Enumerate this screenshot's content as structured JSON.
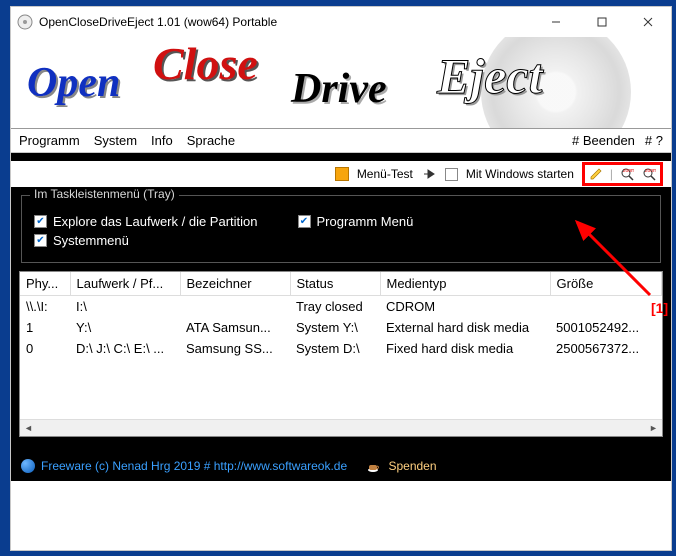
{
  "window": {
    "title": "OpenCloseDriveEject 1.01  (wow64)  Portable"
  },
  "banner": {
    "w1": "Open",
    "w2": "Close",
    "w3": "Drive",
    "w4": "Eject"
  },
  "menu": {
    "items": [
      "Programm",
      "System",
      "Info",
      "Sprache"
    ],
    "right": [
      "# Beenden",
      "# ?"
    ]
  },
  "toolbar": {
    "menu_test": "Menü-Test",
    "autostart": "Mit Windows starten"
  },
  "tray_group": {
    "legend": "Im Taskleistenmenü (Tray)",
    "opt1": "Explore das Laufwerk / die Partition",
    "opt2": "Programm Menü",
    "opt3": "Systemmenü"
  },
  "table": {
    "headers": [
      "Phy...",
      "Laufwerk / Pf...",
      "Bezeichner",
      "Status",
      "Medientyp",
      "Größe"
    ],
    "rows": [
      [
        "\\\\.\\I:",
        "I:\\",
        "",
        "Tray closed",
        "CDROM",
        ""
      ],
      [
        "1",
        "Y:\\",
        "ATA Samsun...",
        "System Y:\\",
        "External hard disk media",
        "5001052492..."
      ],
      [
        "0",
        "D:\\ J:\\ C:\\ E:\\ ...",
        "Samsung SS...",
        "System D:\\",
        "Fixed hard disk media",
        "2500567372..."
      ]
    ]
  },
  "footer": {
    "credit": "Freeware (c) Nenad Hrg 2019 # http://www.softwareok.de",
    "donate": "Spenden"
  },
  "annot": {
    "label": "[1]"
  }
}
